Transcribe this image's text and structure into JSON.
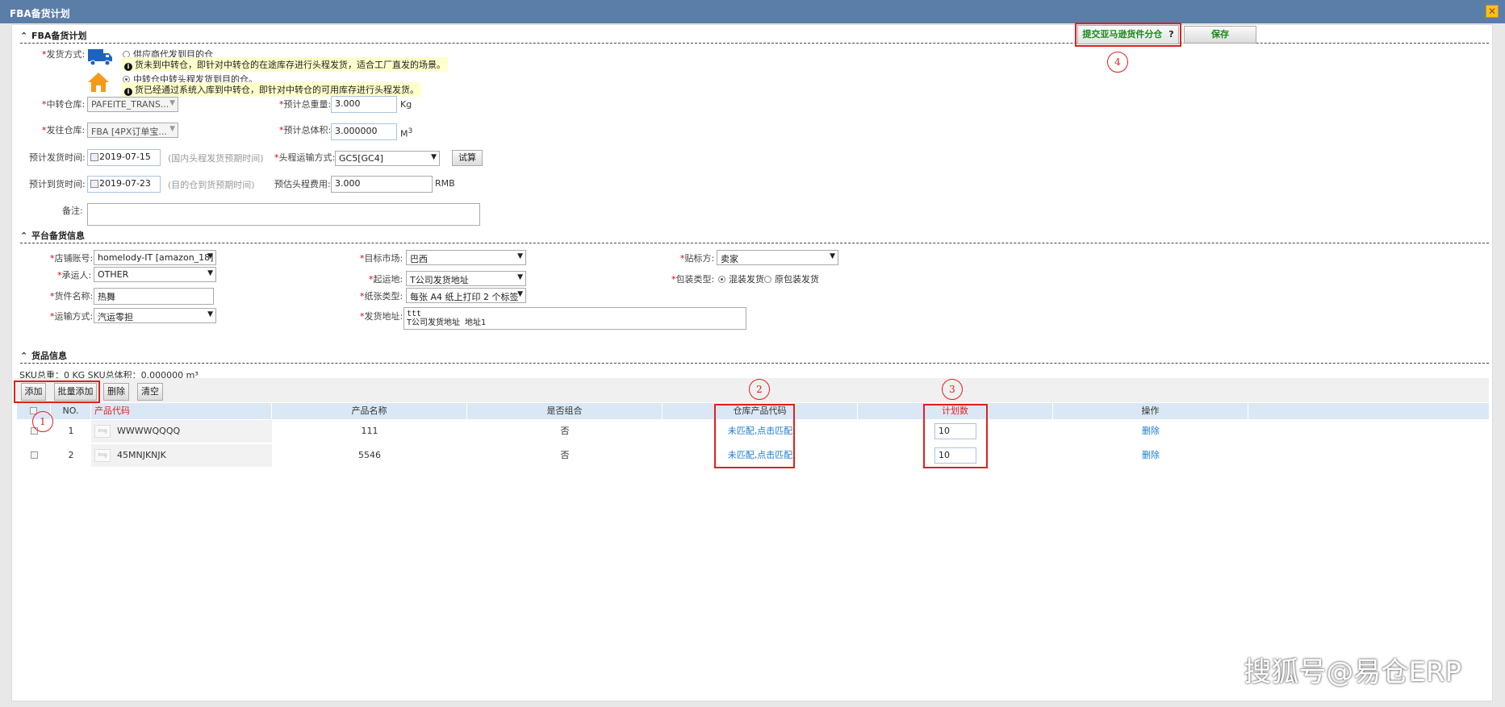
{
  "window": {
    "title": "FBA备货计划",
    "close_glyph": "✕"
  },
  "toolbar": {
    "submit_label": "提交亚马逊货件分仓",
    "help_glyph": "?",
    "save_label": "保存"
  },
  "section_plan": {
    "title": "FBA备货计划",
    "ship_mode_label": "发货方式:",
    "option1_label": "供应商代发到目的仓",
    "option1_notice": "货未到中转仓，即针对中转仓的在途库存进行头程发货，适合工厂直发的场景。",
    "option2_label": "中转仓中转头程发货到目的仓。",
    "option2_notice": "货已经通过系统入库到中转仓，即针对中转仓的可用库存进行头程发货。",
    "transit_wh_label": "中转仓库:",
    "transit_wh_value": "PAFEITE_TRANS...",
    "weight_label": "预计总重量:",
    "weight_value": "3.000",
    "weight_unit": "Kg",
    "dest_wh_label": "发往仓库:",
    "dest_wh_value": "FBA [4PX订单宝...",
    "volume_label": "预计总体积:",
    "volume_value": "3.000000",
    "volume_unit": "M",
    "volume_sup": "3",
    "ship_date_label": "预计发货时间:",
    "ship_date_value": "2019-07-15",
    "ship_date_hint": "(国内头程发货预期时间)",
    "transport_label": "头程运输方式:",
    "transport_value": "GC5[GC4]",
    "calc_label": "试算",
    "arrive_date_label": "预计到货时间:",
    "arrive_date_value": "2019-07-23",
    "arrive_date_hint": "(目的仓到货预期时间)",
    "fee_label": "预估头程费用:",
    "fee_value": "3.000",
    "fee_unit": "RMB",
    "remark_label": "备注:"
  },
  "section_platform": {
    "title": "平台备货信息",
    "store_label": "店铺账号:",
    "store_value": "homelody-IT [amazon_18]",
    "market_label": "目标市场:",
    "market_value": "巴西",
    "labeler_label": "贴标方:",
    "labeler_value": "卖家",
    "carrier_label": "承运人:",
    "carrier_value": "OTHER",
    "origin_label": "起运地:",
    "origin_value": "T公司发货地址",
    "pack_label": "包装类型:",
    "pack_opt1": "混装发货",
    "pack_opt2": "原包装发货",
    "goods_name_label": "货件名称:",
    "goods_name_value": "热舞",
    "paper_label": "纸张类型:",
    "paper_value": "每张 A4 纸上打印 2 个标签",
    "ship_method_label": "运输方式:",
    "ship_method_value": "汽运零担",
    "address_label": "发货地址:",
    "address_line1": "ttt",
    "address_line2": "T公司发货地址 地址1"
  },
  "section_goods": {
    "title": "货品信息",
    "summary": "SKU总重：0 KG SKU总体积：0.000000 m³",
    "btn_add": "添加",
    "btn_batch_add": "批量添加",
    "btn_delete": "删除",
    "btn_clear": "清空",
    "columns": {
      "no": "NO.",
      "code": "产品代码",
      "name": "产品名称",
      "combo": "是否组合",
      "wh_code": "仓库产品代码",
      "plan_qty": "计划数",
      "ops": "操作"
    },
    "rows": [
      {
        "no": "1",
        "code": "WWWWQQQQ",
        "name": "111",
        "combo": "否",
        "wh_code": "未匹配,点击匹配",
        "qty": "10",
        "op": "删除"
      },
      {
        "no": "2",
        "code": "45MNJKNJK",
        "name": "5546",
        "combo": "否",
        "wh_code": "未匹配,点击匹配",
        "qty": "10",
        "op": "删除"
      }
    ]
  },
  "annotations": {
    "n1": "1",
    "n2": "2",
    "n3": "3",
    "n4": "4"
  },
  "watermark": "搜狐号@易仓ERP",
  "colors": {
    "titlebar": "#5b7ea9",
    "annotation_red": "#e02020",
    "link_blue": "#1a7bd0",
    "header_row": "#dae8f5",
    "notice_bg": "#ffffcc"
  }
}
